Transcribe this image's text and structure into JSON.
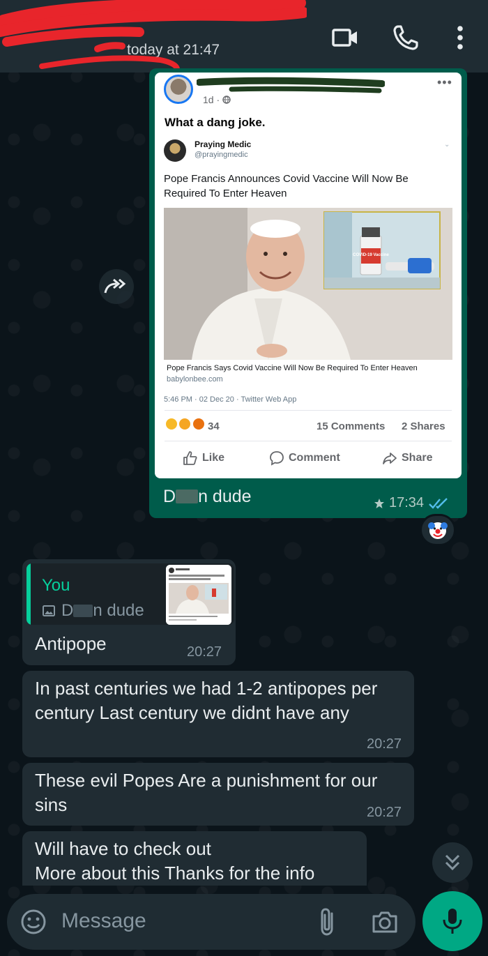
{
  "header": {
    "subtitle": "today at 21:47"
  },
  "forwarded": {
    "post": {
      "time": "1d ·",
      "text": "What a dang joke.",
      "tweet": {
        "name": "Praying Medic",
        "handle": "@prayingmedic",
        "headline": "Pope Francis Announces Covid Vaccine Will Now Be Required To Enter Heaven",
        "vial_label": "COVID-19 Vaccine",
        "caption": "Pope Francis Says Covid Vaccine Will Now Be Required To Enter Heaven",
        "domain": "babylonbee.com",
        "meta": "5:46 PM · 02 Dec 20 · Twitter Web App"
      },
      "reaction_count": "34",
      "comments": "15 Comments",
      "shares": "2 Shares",
      "like_label": "Like",
      "comment_label": "Comment",
      "share_label": "Share"
    },
    "caption_start": "D",
    "caption_end": "n dude",
    "time": "17:34",
    "reaction_emoji": "clown-face"
  },
  "messages": [
    {
      "quote_author": "You",
      "quote_text_start": "D",
      "quote_text_end": "n dude",
      "text": "Antipope",
      "time": "20:27"
    },
    {
      "text": "In past centuries we had 1-2 antipopes per century Last century we didnt have any",
      "time": "20:27"
    },
    {
      "text": "These evil Popes Are a punishment for our sins",
      "time": "20:27"
    },
    {
      "text_line1": "Will have to check out",
      "text_line2": "More about this Thanks for the info"
    }
  ],
  "input": {
    "placeholder": "Message"
  },
  "colors": {
    "background": "#0b141a",
    "header": "#1f2c33",
    "outgoing_bubble": "#005c4b",
    "incoming_bubble": "#202c33",
    "accent": "#00a884",
    "quote_accent": "#06cf9c",
    "redaction": "#e8252b"
  }
}
